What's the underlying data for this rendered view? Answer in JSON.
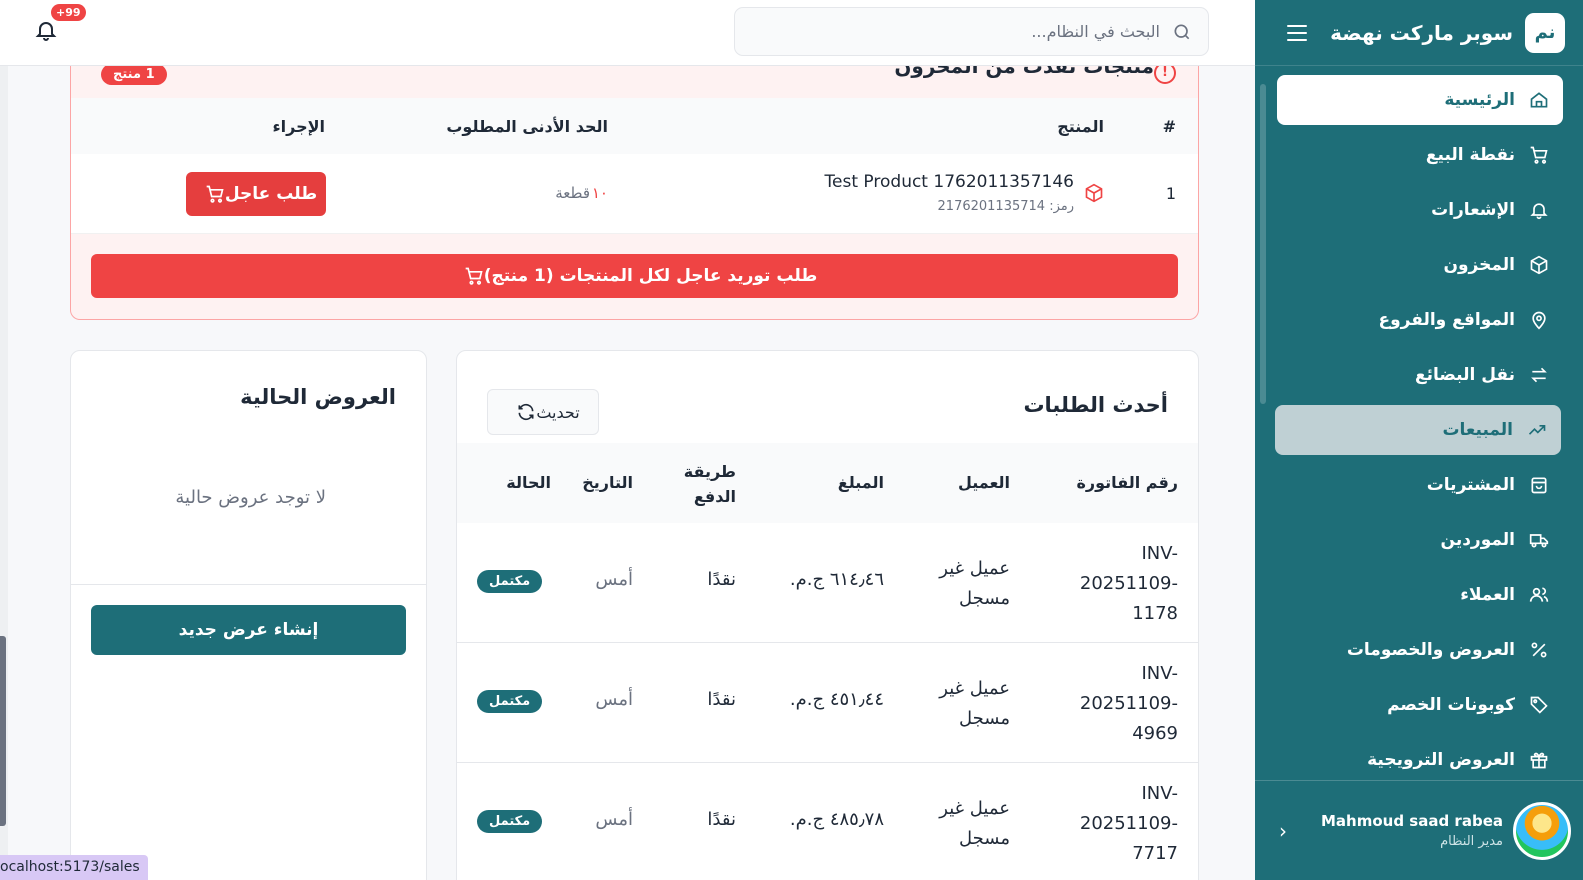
{
  "app": {
    "logo": "نم",
    "name": "سوبر ماركت نهضة"
  },
  "nav": [
    {
      "label": "الرئيسية",
      "icon": "home-icon"
    },
    {
      "label": "نقطة البيع",
      "icon": "cart-icon"
    },
    {
      "label": "الإشعارات",
      "icon": "bell-icon"
    },
    {
      "label": "المخزون",
      "icon": "box-icon"
    },
    {
      "label": "المواقع والفروع",
      "icon": "map-pin-icon"
    },
    {
      "label": "نقل البضائع",
      "icon": "transfer-icon"
    },
    {
      "label": "المبيعات",
      "icon": "trending-up-icon"
    },
    {
      "label": "المشتريات",
      "icon": "shopping-bag-icon"
    },
    {
      "label": "الموردين",
      "icon": "truck-icon"
    },
    {
      "label": "العملاء",
      "icon": "users-icon"
    },
    {
      "label": "العروض والخصومات",
      "icon": "percent-icon"
    },
    {
      "label": "كوبونات الخصم",
      "icon": "tag-icon"
    },
    {
      "label": "العروض الترويجية",
      "icon": "gift-icon"
    }
  ],
  "user": {
    "name": "Mahmoud saad rabea",
    "role": "مدير النظام"
  },
  "search": {
    "placeholder": "البحث في النظام..."
  },
  "notifications": {
    "badge": "+99"
  },
  "alert": {
    "title": "منتجات نفدت من المخزون",
    "count": "1 منتج",
    "columns": {
      "num": "#",
      "product": "المنتج",
      "min": "الحد الأدنى المطلوب",
      "action": "الإجراء"
    },
    "row": {
      "num": "1",
      "name": "Test Product 1762011357146",
      "code": "رمز: 2176201135714",
      "min": "١٠",
      "unit": "قطعة",
      "action": "طلب عاجل"
    },
    "bulk_button": "طلب توريد عاجل لكل المنتجات (1 منتج)"
  },
  "orders": {
    "title": "أحدث الطلبات",
    "refresh": "تحديث",
    "columns": {
      "invoice": "رقم الفاتورة",
      "customer": "العميل",
      "amount": "المبلغ",
      "payment": "طريقة الدفع",
      "date": "التاريخ",
      "status": "الحالة"
    },
    "rows": [
      {
        "invoice_a": "INV-",
        "invoice_b": "20251109-",
        "invoice_c": "1178",
        "customer_a": "عميل غير",
        "customer_b": "مسجل",
        "amount": "٦١٤٫٤٦ ج.م.",
        "payment": "نقدًا",
        "date": "أمس",
        "status": "مكتمل"
      },
      {
        "invoice_a": "INV-",
        "invoice_b": "20251109-",
        "invoice_c": "4969",
        "customer_a": "عميل غير",
        "customer_b": "مسجل",
        "amount": "٤٥١٫٤٤ ج.م.",
        "payment": "نقدًا",
        "date": "أمس",
        "status": "مكتمل"
      },
      {
        "invoice_a": "INV-",
        "invoice_b": "20251109-",
        "invoice_c": "7717",
        "customer_a": "عميل غير",
        "customer_b": "مسجل",
        "amount": "٤٨٥٫٧٨ ج.م.",
        "payment": "نقدًا",
        "date": "أمس",
        "status": "مكتمل"
      }
    ]
  },
  "offers": {
    "title": "العروض الحالية",
    "empty": "لا توجد عروض حالية",
    "create": "إنشاء عرض جديد"
  },
  "status_url": "ocalhost:5173/sales",
  "colors": {
    "primary": "#1e6e78",
    "danger": "#ef4444",
    "nav_selected_bg": "#bfd0d4"
  }
}
